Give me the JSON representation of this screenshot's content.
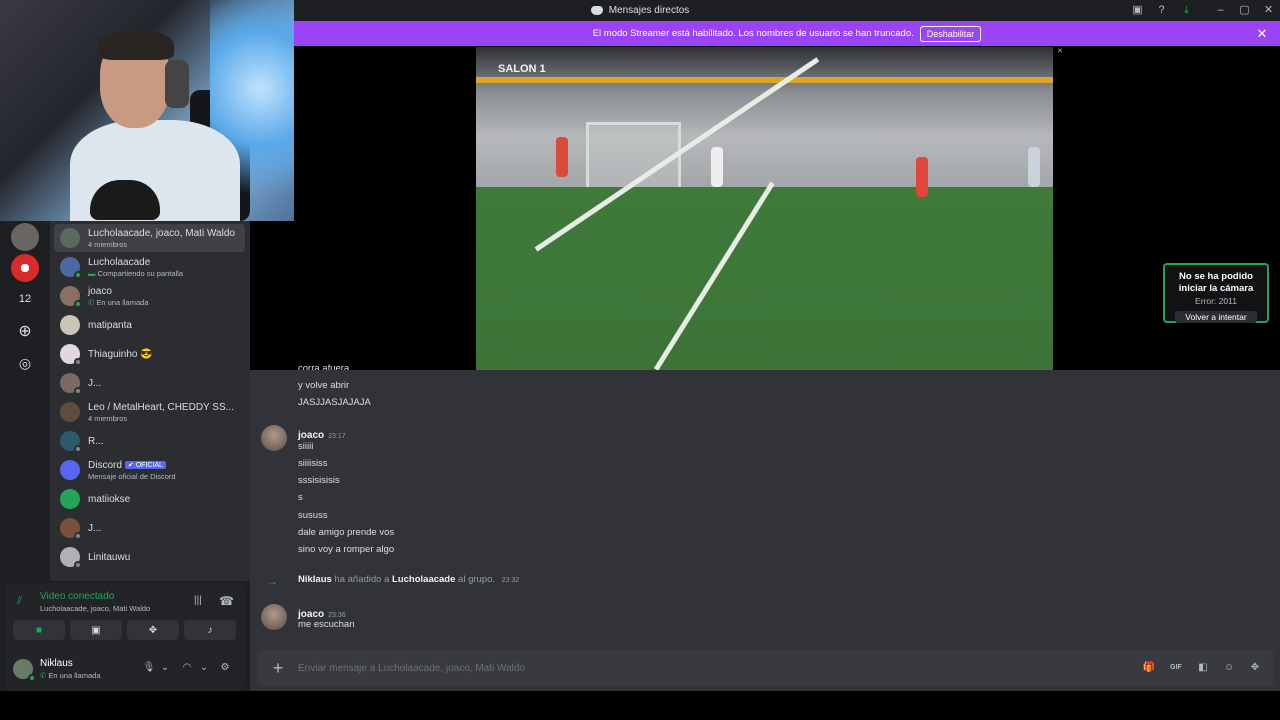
{
  "window": {
    "title": "Mensajes directos"
  },
  "banner": {
    "text": "El modo Streamer está habilitado. Los nombres de usuario se han truncado.",
    "button": "Deshabilitar"
  },
  "servers": {
    "count_label": "12"
  },
  "dm_list": [
    {
      "name": "Lucholaacade, joaco, Mati Waldo",
      "sub": "4 miembros",
      "active": true
    },
    {
      "name": "Lucholaacade",
      "sub": "Compartiendo su pantalla",
      "status_color": "#23a559"
    },
    {
      "name": "joaco",
      "sub": "En una llamada",
      "status_color": "#23a559"
    },
    {
      "name": "matipanta",
      "sub": ""
    },
    {
      "name": "Thiaguinho 😎",
      "sub": ""
    },
    {
      "name": "J...",
      "sub": ""
    },
    {
      "name": "Leo / MetalHeart, CHEDDY SS...",
      "sub": "4 miembros"
    },
    {
      "name": "R...",
      "sub": ""
    },
    {
      "name": "Discord",
      "badge": "✔ OFICIAL",
      "sub": "Mensaje oficial de Discord"
    },
    {
      "name": "matiiokse",
      "sub": ""
    },
    {
      "name": "J...",
      "sub": ""
    },
    {
      "name": "Linitauwu",
      "sub": ""
    }
  ],
  "voice": {
    "title": "Video conectado",
    "channel": "Lucholaacade, joaco, Mati Waldo"
  },
  "user": {
    "name": "Niklaus",
    "status": "En una llamada"
  },
  "stage": {
    "video_sign": "SALON 1",
    "camera_error": {
      "title": "No se ha podido iniciar la cámara",
      "error": "Error: 2011",
      "button": "Volver a intentar"
    }
  },
  "messages": {
    "partial": [
      "corra afuera",
      "y volve abrir",
      "JASJJASJAJAJA"
    ],
    "group1": {
      "author": "joaco",
      "time": "23:17",
      "lines": [
        "siiiii",
        "siiiisiss",
        "sssisisisis",
        "s",
        "sususs",
        "dale amigo prende vos",
        "sino voy a romper algo"
      ]
    },
    "system": {
      "actor": "Niklaus",
      "action": "ha añadido a",
      "target": "Lucholaacade",
      "suffix": "al grupo.",
      "time": "23:32"
    },
    "group2": {
      "author": "joaco",
      "time": "23:36",
      "lines": [
        "me escuchan"
      ]
    }
  },
  "composer": {
    "placeholder": "Enviar mensaje a Lucholaacade, joaco, Mati Waldo"
  },
  "colors": {
    "banner": "#9b44f7",
    "online": "#23a559",
    "brand": "#5865f2"
  }
}
